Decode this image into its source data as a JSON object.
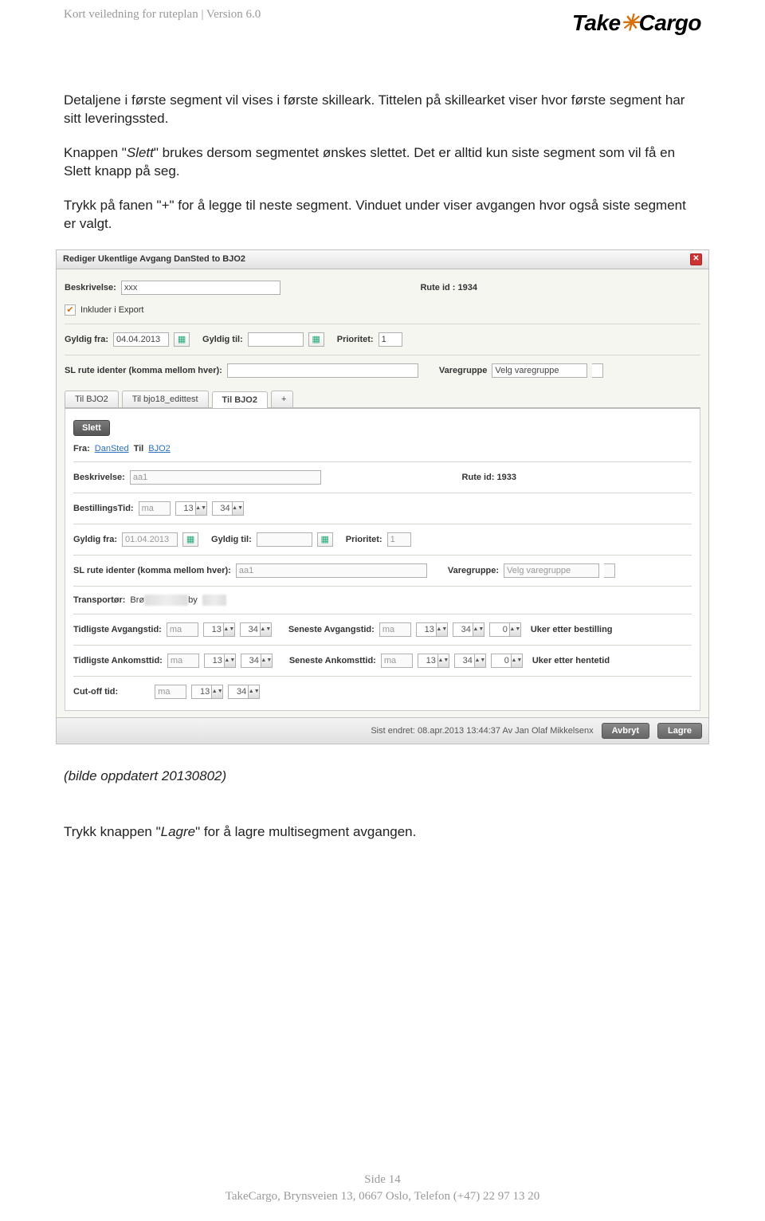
{
  "header": {
    "doc_title": "Kort veiledning for ruteplan | Version 6.0",
    "logo_take": "Take",
    "logo_cargo": "Cargo"
  },
  "body": {
    "p1": "Detaljene i første segment vil vises i første skilleark. Tittelen på skillearket viser hvor første segment har sitt leveringssted.",
    "p2a": "Knappen \"",
    "p2b": "Slett",
    "p2c": "\" brukes dersom segmentet ønskes slettet. Det er alltid kun siste segment som vil få en Slett knapp på seg.",
    "p3": "Trykk på fanen \"+\" for å legge til neste segment. Vinduet under viser avgangen hvor også siste segment er valgt."
  },
  "app": {
    "title": "Rediger Ukentlige Avgang DanSted to BJO2",
    "beskrivelse_lbl": "Beskrivelse:",
    "beskrivelse_val": "xxx",
    "ruteid_top": "Rute id : 1934",
    "inkluder": "Inkluder i Export",
    "gyldig_fra_lbl": "Gyldig fra:",
    "gyldig_fra_val": "04.04.2013",
    "gyldig_til_lbl": "Gyldig til:",
    "prioritet_lbl": "Prioritet:",
    "prioritet_val": "1",
    "sl_rute_lbl": "SL rute identer (komma mellom hver):",
    "varegruppe_lbl": "Varegruppe",
    "varegruppe_val": "Velg varegruppe",
    "tabs": [
      "Til BJO2",
      "Til bjo18_edittest",
      "Til BJO2",
      "+"
    ],
    "slett": "Slett",
    "fra_lbl": "Fra:",
    "fra_link": "DanSted",
    "til_lbl": "Til",
    "til_link": "BJO2",
    "beskrivelse2_val": "aa1",
    "ruteid2": "Rute id: 1933",
    "bestillingstid_lbl": "BestillingsTid:",
    "bestillingstid_day": "ma",
    "bestillingstid_h": "13",
    "bestillingstid_m": "34",
    "gyldig_fra2": "01.04.2013",
    "varegruppe2_lbl": "Varegruppe:",
    "varegruppe2_val": "Velg varegruppe",
    "transporter_lbl": "Transportør:",
    "transporter_val1": "Brø",
    "transporter_val2": "by",
    "tidligste_avg_lbl": "Tidligste Avgangstid:",
    "seneste_avg_lbl": "Seneste Avgangstid:",
    "tidligste_ank_lbl": "Tidligste Ankomsttid:",
    "seneste_ank_lbl": "Seneste Ankomsttid:",
    "uker_bestilling": "Uker etter bestilling",
    "uker_hentetid": "Uker etter hentetid",
    "cutoff_lbl": "Cut-off tid:",
    "day": "ma",
    "h13": "13",
    "m34": "34",
    "zero": "0",
    "sist_endret": "Sist endret: 08.apr.2013 13:44:37 Av Jan Olaf Mikkelsenx",
    "avbryt": "Avbryt",
    "lagre": "Lagre"
  },
  "below": {
    "caption": "(bilde oppdatert 20130802)",
    "line1a": "Trykk knappen \"",
    "line1b": "Lagre",
    "line1c": "\" for å lagre multisegment avgangen."
  },
  "footer": {
    "side": "Side 14",
    "addr": "TakeCargo, Brynsveien 13, 0667 Oslo, Telefon (+47)  22 97 13 20"
  }
}
